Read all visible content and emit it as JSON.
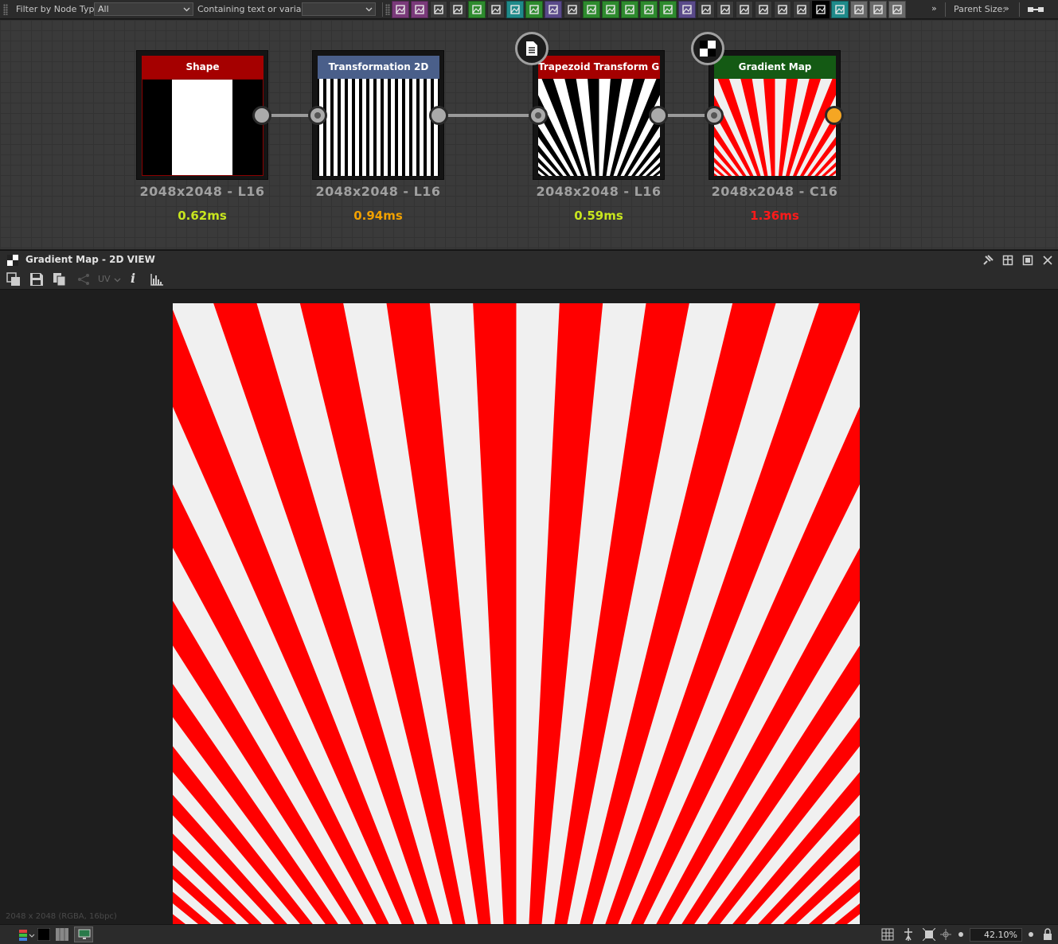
{
  "toolbar": {
    "filter_label": "Filter by Node Type",
    "filter_value": "All",
    "contains_label": "Containing text or variable",
    "contains_value": "",
    "more": "»",
    "parent_size_label": "Parent Size:",
    "parent_chevron": "»",
    "icons": [
      {
        "name": "bitmap-icon",
        "color": "#7a3a7a"
      },
      {
        "name": "svg-icon",
        "color": "#7a3a7a"
      },
      {
        "name": "uniform-color-icon",
        "color": "#3c3c3c"
      },
      {
        "name": "shuffle-icon",
        "color": "#3c3c3c"
      },
      {
        "name": "curve-icon",
        "color": "#2e8b2e"
      },
      {
        "name": "levels-icon",
        "color": "#3c3c3c"
      },
      {
        "name": "transform-icon",
        "color": "#1f8a8a"
      },
      {
        "name": "gradient-icon",
        "color": "#2e8b2e"
      },
      {
        "name": "blur-icon",
        "color": "#5a4a8a"
      },
      {
        "name": "tile-icon",
        "color": "#3c3c3c"
      },
      {
        "name": "bucket-icon",
        "color": "#2e8b2e"
      },
      {
        "name": "warp-icon",
        "color": "#2e8b2e"
      },
      {
        "name": "blend-icon",
        "color": "#2e8b2e"
      },
      {
        "name": "invert-icon",
        "color": "#2e8b2e"
      },
      {
        "name": "histogram-icon",
        "color": "#2e8b2e"
      },
      {
        "name": "hsl-icon",
        "color": "#5a4a8a"
      },
      {
        "name": "noise-icon",
        "color": "#3c3c3c"
      },
      {
        "name": "text-shape-icon",
        "color": "#3c3c3c"
      },
      {
        "name": "normal-icon",
        "color": "#3c3c3c"
      },
      {
        "name": "text-icon",
        "color": "#3c3c3c"
      },
      {
        "name": "frame-icon",
        "color": "#3c3c3c"
      },
      {
        "name": "fill-icon",
        "color": "#3c3c3c"
      },
      {
        "name": "fx-map-icon",
        "color": "#000000"
      },
      {
        "name": "pixel-processor-icon",
        "color": "#1f8a8a"
      },
      {
        "name": "input-icon",
        "color": "#6a6a6a"
      },
      {
        "name": "output-icon",
        "color": "#6a6a6a"
      },
      {
        "name": "graph-icon",
        "color": "#6a6a6a"
      }
    ]
  },
  "nodes": [
    {
      "title": "Shape",
      "size": "2048x2048 - L16",
      "time": "0.62ms",
      "time_color": "#c8e61e",
      "header_color": "#a50000"
    },
    {
      "title": "Transformation 2D",
      "size": "2048x2048 - L16",
      "time": "0.94ms",
      "time_color": "#f0a000",
      "header_color": "#4a5f8a"
    },
    {
      "title": "Trapezoid Transform G...",
      "size": "2048x2048 - L16",
      "time": "0.59ms",
      "time_color": "#c8e61e",
      "header_color": "#a50000"
    },
    {
      "title": "Gradient Map",
      "size": "2048x2048 - C16",
      "time": "1.36ms",
      "time_color": "#ff1a1a",
      "header_color": "#145a14"
    }
  ],
  "view": {
    "title": "Gradient Map - 2D VIEW",
    "uv_label": "UV",
    "info_label": "i",
    "image_info": "2048 x 2048 (RGBA, 16bpc)",
    "stripe_color": "#ff0000",
    "base_color": "#f0f0f0"
  },
  "status": {
    "zoom": "42.10%"
  }
}
